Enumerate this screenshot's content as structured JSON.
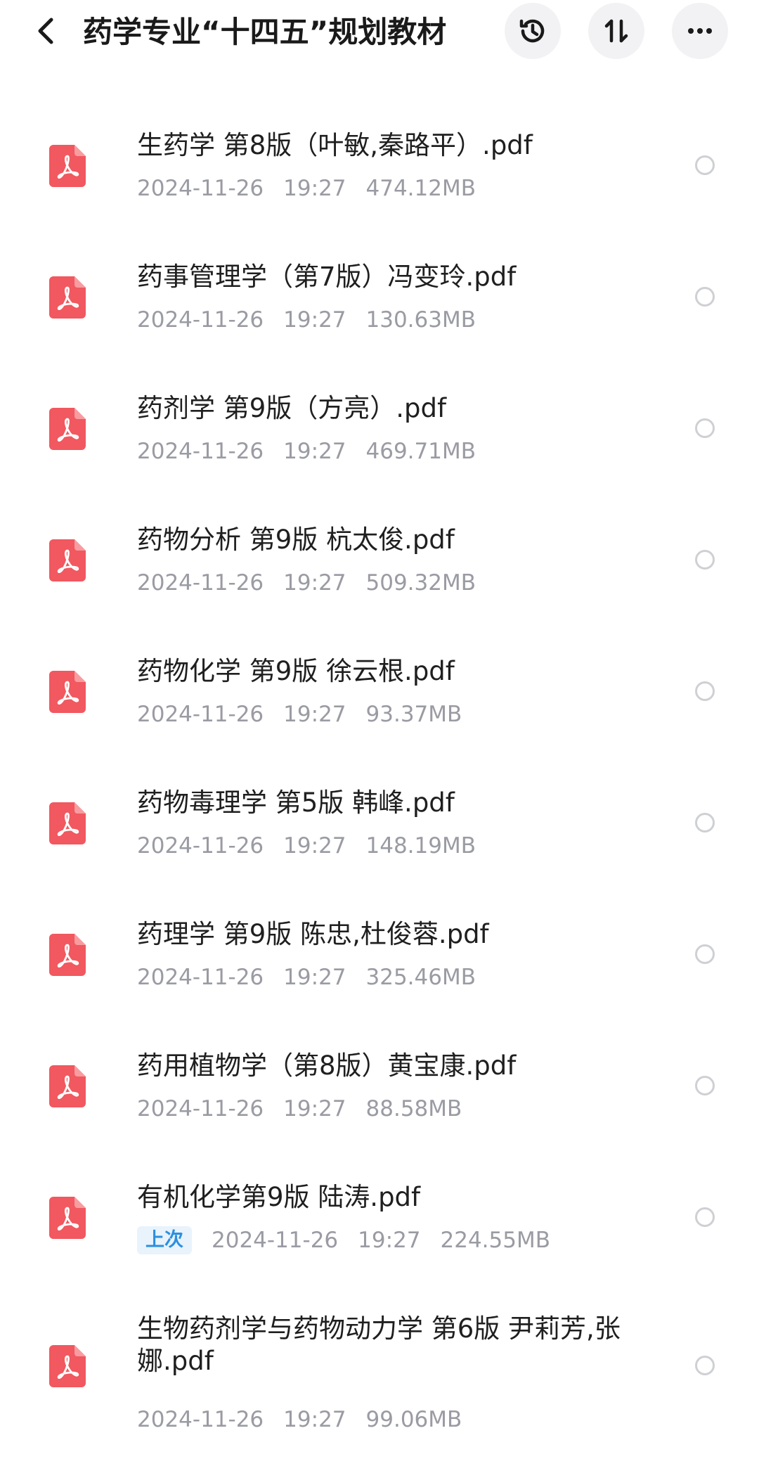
{
  "header": {
    "title": "药学专业“十四五”规划教材",
    "icons": {
      "back": "back-arrow-icon",
      "history": "history-icon",
      "sort": "sort-icon",
      "more": "more-icon"
    }
  },
  "colors": {
    "pdf_icon": "#f1585f",
    "badge_bg": "#e8f3fc",
    "badge_text": "#2c8fde",
    "meta_text": "#9a9ba3"
  },
  "files": [
    {
      "name": "生药学 第8版（叶敏,秦路平）.pdf",
      "date": "2024-11-26",
      "time": "19:27",
      "size": "474.12MB",
      "badge": ""
    },
    {
      "name": "药事管理学（第7版）冯变玲.pdf",
      "date": "2024-11-26",
      "time": "19:27",
      "size": "130.63MB",
      "badge": ""
    },
    {
      "name": "药剂学 第9版（方亮）.pdf",
      "date": "2024-11-26",
      "time": "19:27",
      "size": "469.71MB",
      "badge": ""
    },
    {
      "name": "药物分析 第9版 杭太俊.pdf",
      "date": "2024-11-26",
      "time": "19:27",
      "size": "509.32MB",
      "badge": ""
    },
    {
      "name": "药物化学 第9版 徐云根.pdf",
      "date": "2024-11-26",
      "time": "19:27",
      "size": "93.37MB",
      "badge": ""
    },
    {
      "name": "药物毒理学 第5版 韩峰.pdf",
      "date": "2024-11-26",
      "time": "19:27",
      "size": "148.19MB",
      "badge": ""
    },
    {
      "name": "药理学 第9版 陈忠,杜俊蓉.pdf",
      "date": "2024-11-26",
      "time": "19:27",
      "size": "325.46MB",
      "badge": ""
    },
    {
      "name": "药用植物学（第8版）黄宝康.pdf",
      "date": "2024-11-26",
      "time": "19:27",
      "size": "88.58MB",
      "badge": ""
    },
    {
      "name": "有机化学第9版 陆涛.pdf",
      "date": "2024-11-26",
      "time": "19:27",
      "size": "224.55MB",
      "badge": "上次"
    },
    {
      "name": "生物药剂学与药物动力学 第6版 尹莉芳,张娜.pdf",
      "date": "2024-11-26",
      "time": "19:27",
      "size": "99.06MB",
      "badge": ""
    }
  ]
}
